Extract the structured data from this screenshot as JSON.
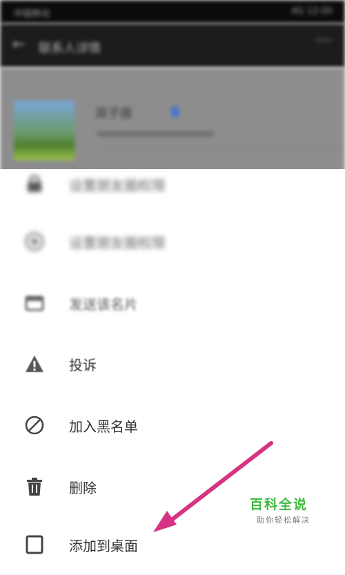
{
  "status_bar": {
    "carrier": "中国移动",
    "right": "4G 12:00"
  },
  "title_bar": {
    "title": "联系人详情"
  },
  "contact": {
    "name": "双子座"
  },
  "menu": {
    "items": [
      {
        "label": "设置朋友圈权限",
        "icon": "lock-icon"
      },
      {
        "label": "设置朋友圈权限",
        "icon": "circle-icon"
      },
      {
        "label": "发送该名片",
        "icon": "card-icon"
      },
      {
        "label": "投诉",
        "icon": "warning-icon"
      },
      {
        "label": "加入黑名单",
        "icon": "block-icon"
      },
      {
        "label": "删除",
        "icon": "trash-icon"
      },
      {
        "label": "添加到桌面",
        "icon": "desktop-icon"
      }
    ]
  },
  "annotation": {
    "arrow_color": "#d63384"
  },
  "watermark": {
    "main": "百科全说",
    "sub": "助你轻松解决"
  }
}
